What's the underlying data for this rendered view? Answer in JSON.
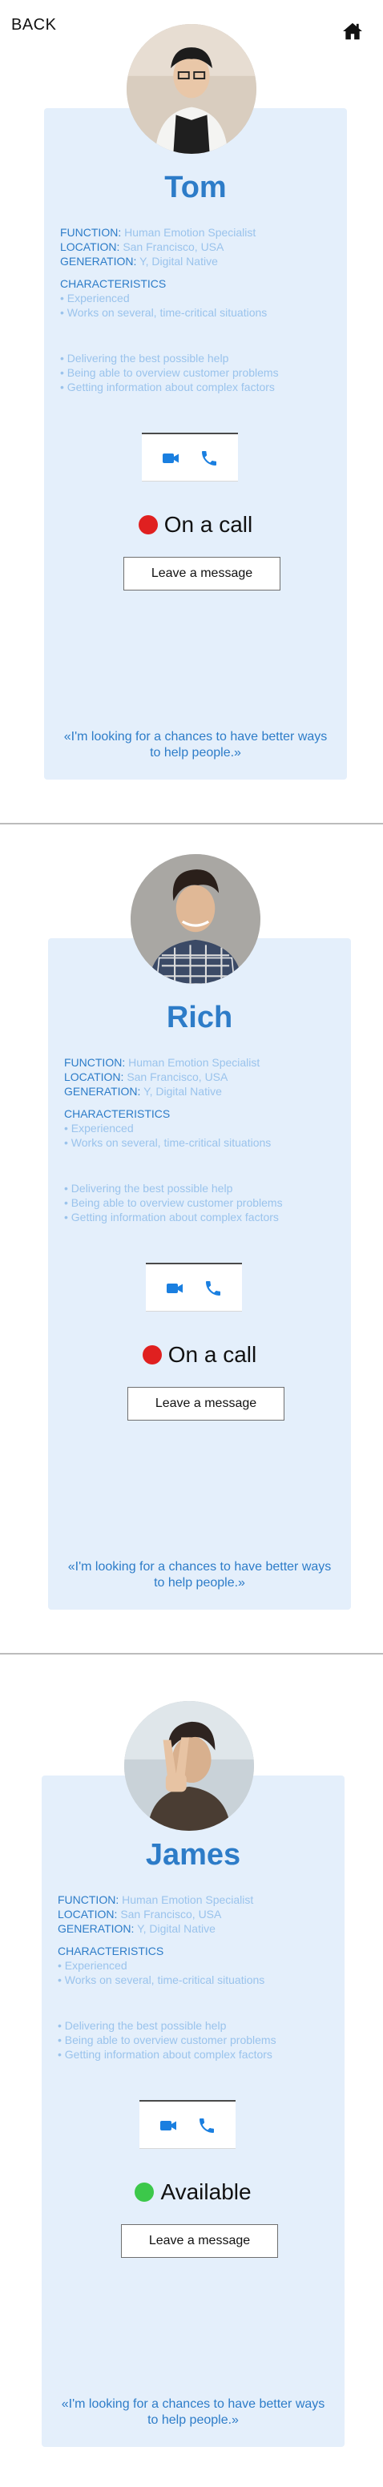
{
  "nav": {
    "back_label": "BACK",
    "home_icon": "home-icon"
  },
  "labels": {
    "function": "FUNCTION:",
    "location": "LOCATION:",
    "generation": "GENERATION:",
    "characteristics": "CHARACTERISTICS",
    "leave_message": "Leave a message"
  },
  "colors": {
    "accent": "#2d7cc8",
    "muted_text": "#9ac3ec",
    "card_bg": "#e4effb",
    "status_busy": "#e02020",
    "status_available": "#3cc84a",
    "call_icon": "#1a7fe0"
  },
  "profiles": [
    {
      "name": "Tom",
      "function": "Human Emotion Specialist",
      "location": "San Francisco, USA",
      "generation": "Y, Digital Native",
      "characteristics": [
        "• Experienced",
        "• Works on several, time-critical situations"
      ],
      "strengths": [
        "• Delivering the best possible help",
        "• Being able to overview customer problems",
        "• Getting information about complex factors"
      ],
      "status": "On a call",
      "quote": "«I'm looking for a chances to have better ways to help people.»",
      "photo_icon": "person-photo"
    },
    {
      "name": "Rich",
      "function": "Human Emotion Specialist",
      "location": "San Francisco, USA",
      "generation": "Y, Digital Native",
      "characteristics": [
        "• Experienced",
        "• Works on several, time-critical situations"
      ],
      "strengths": [
        "• Delivering the best possible help",
        "• Being able to overview customer problems",
        "• Getting information about complex factors"
      ],
      "status": "On a call",
      "quote": "«I'm looking for a chances to have better ways to help people.»",
      "photo_icon": "person-photo"
    },
    {
      "name": "James",
      "function": "Human Emotion Specialist",
      "location": "San Francisco, USA",
      "generation": "Y, Digital Native",
      "characteristics": [
        "• Experienced",
        "• Works on several, time-critical situations"
      ],
      "strengths": [
        "• Delivering the best possible help",
        "• Being able to overview customer problems",
        "• Getting information about complex factors"
      ],
      "status": "Available",
      "quote": "«I'm looking for a chances to have better ways to help people.»",
      "photo_icon": "person-photo"
    }
  ]
}
